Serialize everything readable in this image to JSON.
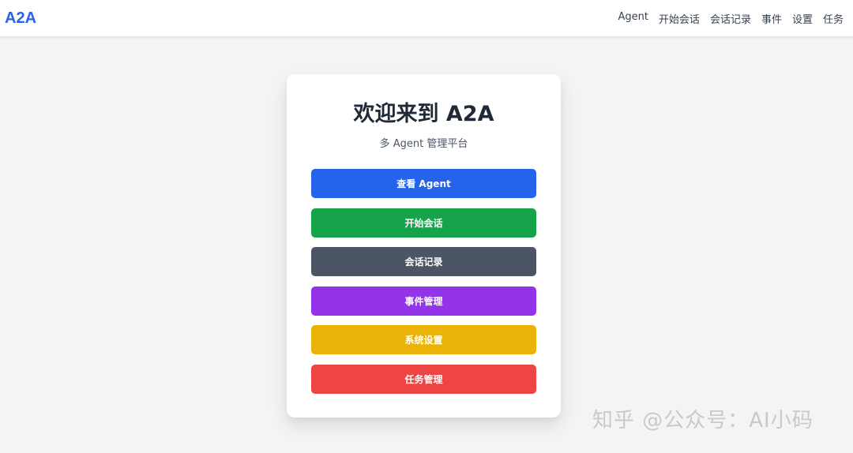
{
  "header": {
    "brand": "A2A",
    "nav": [
      {
        "label": "Agent"
      },
      {
        "label": "开始会话"
      },
      {
        "label": "会话记录"
      },
      {
        "label": "事件"
      },
      {
        "label": "设置"
      },
      {
        "label": "任务"
      }
    ]
  },
  "card": {
    "title": "欢迎来到 A2A",
    "subtitle": "多 Agent 管理平台",
    "buttons": [
      {
        "label": "查看 Agent",
        "color": "#2563eb"
      },
      {
        "label": "开始会话",
        "color": "#16a34a"
      },
      {
        "label": "会话记录",
        "color": "#4b5563"
      },
      {
        "label": "事件管理",
        "color": "#9333ea"
      },
      {
        "label": "系统设置",
        "color": "#eab308"
      },
      {
        "label": "任务管理",
        "color": "#ef4444"
      }
    ]
  },
  "watermark": "知乎 @公众号：AI小码"
}
